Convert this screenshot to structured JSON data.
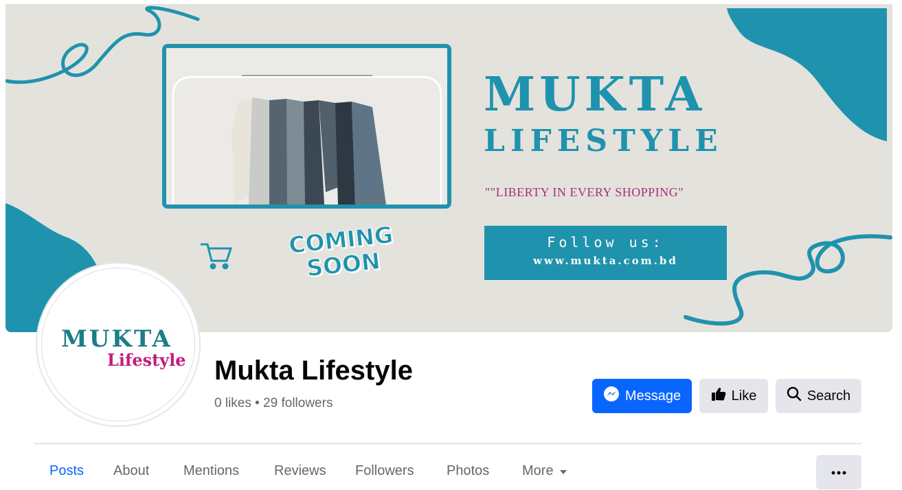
{
  "cover": {
    "brand_line1": "MUKTA",
    "brand_line2": "LIFESTYLE",
    "tagline": "\"\"LIBERTY IN EVERY SHOPPING\"",
    "follow_label": "Follow us:",
    "website": "www.mukta.com.bd",
    "coming_line1": "COMING",
    "coming_line2": "SOON",
    "accent_color": "#1f93ad",
    "tagline_color": "#a4307a"
  },
  "avatar": {
    "line1": "MUKTA",
    "line2": "Lifestyle"
  },
  "page": {
    "name": "Mukta Lifestyle",
    "stats": "0 likes • 29 followers"
  },
  "actions": {
    "message_label": "Message",
    "like_label": "Like",
    "search_label": "Search",
    "message_color": "#0866ff"
  },
  "tabs": [
    {
      "label": "Posts",
      "active": true
    },
    {
      "label": "About"
    },
    {
      "label": "Mentions"
    },
    {
      "label": "Reviews"
    },
    {
      "label": "Followers"
    },
    {
      "label": "Photos"
    },
    {
      "label": "More"
    }
  ],
  "icons": [
    "messenger-icon",
    "thumbs-up-icon",
    "search-icon",
    "caret-down-icon",
    "more-dots-icon",
    "shopping-cart-icon"
  ]
}
